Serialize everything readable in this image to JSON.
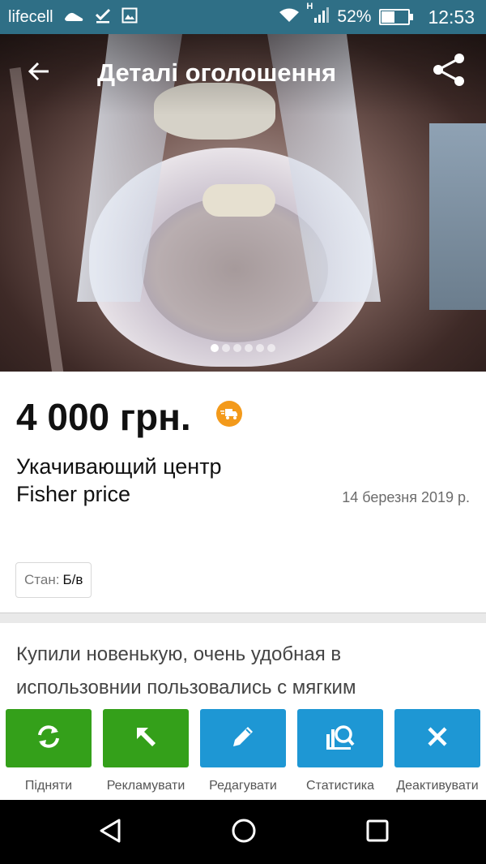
{
  "status_bar": {
    "carrier": "lifecell",
    "battery_percent": "52%",
    "time": "12:53",
    "network_type": "H",
    "battery_level": 0.52,
    "icons": [
      "footprint-icon",
      "check-icon",
      "image-icon",
      "wifi-icon",
      "signal-icon",
      "battery-icon"
    ]
  },
  "toolbar": {
    "title": "Деталі оголошення",
    "back_icon": "arrow-left-icon",
    "share_icon": "share-icon"
  },
  "gallery": {
    "image_count": 6,
    "active_index": 0
  },
  "listing": {
    "price": "4 000 грн.",
    "delivery_icon": "delivery-truck-icon",
    "title_line1": "Укачивающий центр",
    "title_line2": "Fisher price",
    "date": "14 березня 2019 р.",
    "condition_label": "Стан:",
    "condition_value": "Б/в",
    "description_line1": "Купили новенькую, очень удобная в",
    "description_line2": "использовнии пользовались с  мягким"
  },
  "actions": [
    {
      "label": "Підняти",
      "icon": "refresh-icon",
      "color": "#34a01a"
    },
    {
      "label": "Рекламувати",
      "icon": "arrow-up-left-icon",
      "color": "#34a01a"
    },
    {
      "label": "Редагувати",
      "icon": "pencil-icon",
      "color": "#1e97d4"
    },
    {
      "label": "Статистика",
      "icon": "stats-search-icon",
      "color": "#1e97d4"
    },
    {
      "label": "Деактивувати",
      "icon": "close-icon",
      "color": "#1e97d4"
    }
  ],
  "colors": {
    "status_bar": "#2f6f86",
    "accent_green": "#34a01a",
    "accent_blue": "#1e97d4",
    "delivery_badge": "#f39a1b"
  }
}
